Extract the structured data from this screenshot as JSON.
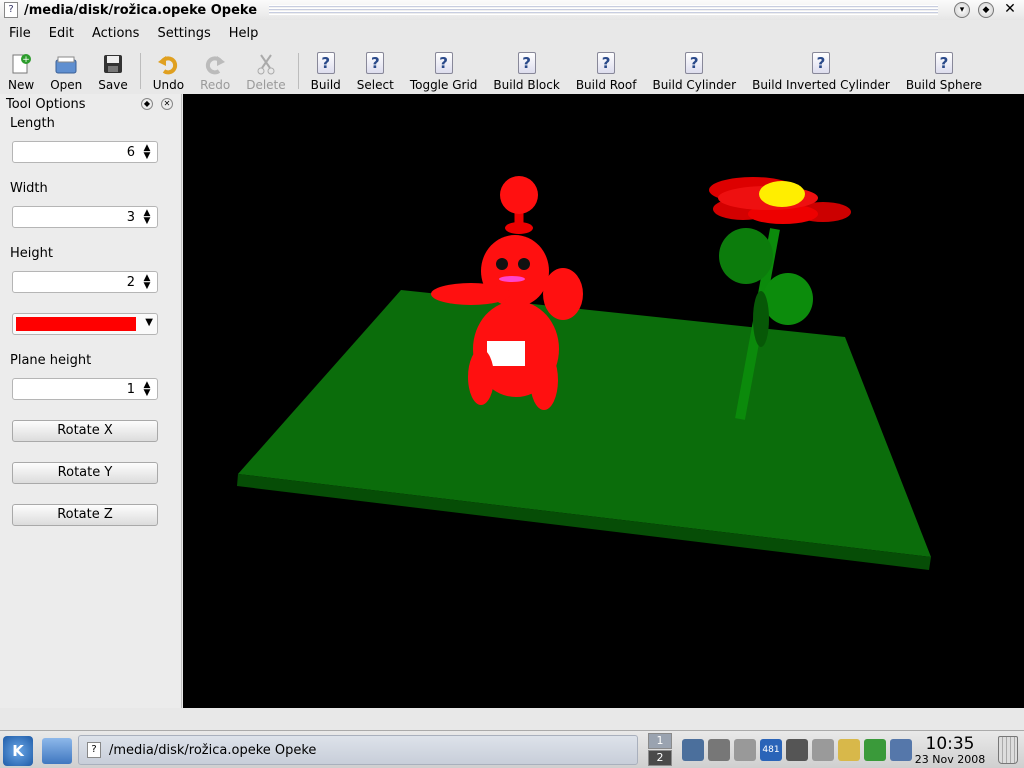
{
  "window": {
    "title": "/media/disk/rožica.opeke Opeke",
    "app_icon": "document-question-icon"
  },
  "menu": [
    "File",
    "Edit",
    "Actions",
    "Settings",
    "Help"
  ],
  "toolbar": {
    "new": "New",
    "open": "Open",
    "save": "Save",
    "undo": "Undo",
    "redo": "Redo",
    "delete": "Delete",
    "build": "Build",
    "select": "Select",
    "toggle_grid": "Toggle Grid",
    "build_block": "Build Block",
    "build_roof": "Build Roof",
    "build_cylinder": "Build Cylinder",
    "build_inverted_cylinder": "Build Inverted Cylinder",
    "build_sphere": "Build Sphere",
    "placeholder_glyph": "?"
  },
  "dock": {
    "title": "Tool Options",
    "length_label": "Length",
    "length_value": "6",
    "width_label": "Width",
    "width_value": "3",
    "height_label": "Height",
    "height_value": "2",
    "color_value": "#ff0000",
    "plane_height_label": "Plane height",
    "plane_height_value": "1",
    "rotate_x": "Rotate X",
    "rotate_y": "Rotate Y",
    "rotate_z": "Rotate Z"
  },
  "taskbar": {
    "task_title": "/media/disk/rožica.opeke Opeke",
    "pager": [
      "1",
      "2"
    ],
    "tray_badge": "481",
    "time": "10:35",
    "date": "23 Nov 2008"
  },
  "colors": {
    "ground": "#0a6b0a",
    "figure": "#ff0000",
    "flower_center": "#ffff00",
    "stem": "#0a8a0a"
  }
}
